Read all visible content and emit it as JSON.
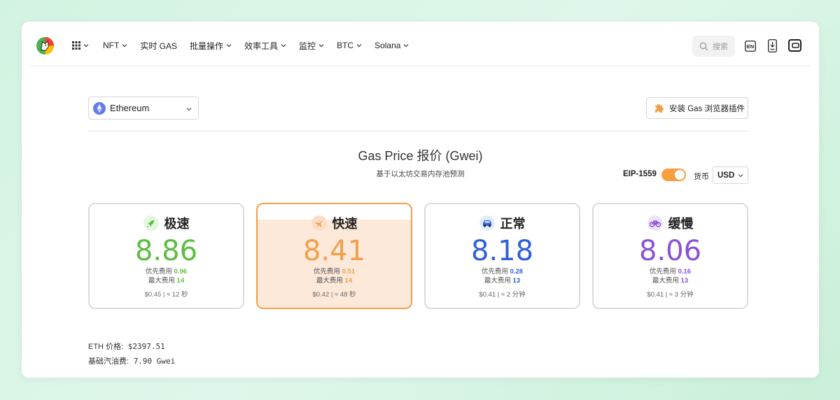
{
  "nav": {
    "menu": [
      {
        "label": "NFT",
        "has_dropdown": true
      },
      {
        "label": "实时 GAS",
        "has_dropdown": false
      },
      {
        "label": "批量操作",
        "has_dropdown": true
      },
      {
        "label": "效率工具",
        "has_dropdown": true
      },
      {
        "label": "监控",
        "has_dropdown": true
      },
      {
        "label": "BTC",
        "has_dropdown": true
      },
      {
        "label": "Solana",
        "has_dropdown": true
      }
    ],
    "search_placeholder": "搜索",
    "lang_badge": "EN"
  },
  "chain_select": {
    "value": "Ethereum"
  },
  "plugin_button": {
    "label": "安装 Gas 浏览器插件"
  },
  "header": {
    "title": "Gas Price 报价 (Gwei)",
    "subtitle": "基于以太坊交易内存池预测"
  },
  "controls": {
    "eip_label": "EIP-1559",
    "eip_enabled": true,
    "currency_label": "货币",
    "currency_value": "USD"
  },
  "tiers": [
    {
      "name": "极速",
      "price": "8.86",
      "priority_label": "优先费用",
      "priority": "0.96",
      "max_label": "最大费用",
      "max": "14",
      "cost": "$0.45",
      "time": "≈ 12 秒",
      "color": "#5bbf3f",
      "icon": "rocket-icon",
      "icon_bg": "#e6f6e0",
      "active": false
    },
    {
      "name": "快速",
      "price": "8.41",
      "priority_label": "优先费用",
      "priority": "0.51",
      "max_label": "最大费用",
      "max": "14",
      "cost": "$0.42",
      "time": "≈ 48 秒",
      "color": "#f0a04b",
      "icon": "airplane-icon",
      "icon_bg": "#fdddc6",
      "active": true,
      "fill_fraction": 0.85
    },
    {
      "name": "正常",
      "price": "8.18",
      "priority_label": "优先费用",
      "priority": "0.28",
      "max_label": "最大费用",
      "max": "13",
      "cost": "$0.41",
      "time": "≈ 2 分钟",
      "color": "#2f5fd9",
      "icon": "car-icon",
      "icon_bg": "#e3ecfb",
      "active": false
    },
    {
      "name": "缓慢",
      "price": "8.06",
      "priority_label": "优先费用",
      "priority": "0.16",
      "max_label": "最大费用",
      "max": "13",
      "cost": "$0.41",
      "time": "≈ 3 分钟",
      "color": "#8a52d6",
      "icon": "bicycle-icon",
      "icon_bg": "#efe4fa",
      "active": false
    }
  ],
  "info": {
    "eth_price_label": "ETH 价格:",
    "eth_price": "$2397.51",
    "base_fee_label": "基础汽油费:",
    "base_fee": "7.90 Gwei"
  }
}
